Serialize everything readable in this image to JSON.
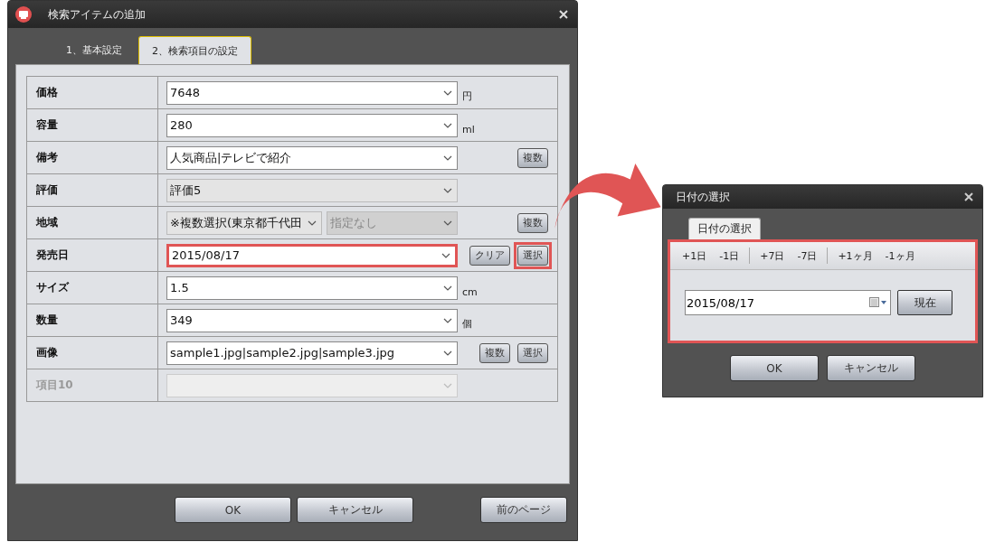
{
  "main_window": {
    "title": "検索アイテムの追加",
    "tabs": [
      {
        "label": "1、基本設定",
        "selected": false
      },
      {
        "label": "2、検索項目の設定",
        "selected": true
      }
    ],
    "rows": [
      {
        "label": "価格",
        "disabled": false,
        "fields": [
          {
            "value": "7648",
            "readonly": false,
            "disabled": false,
            "highlighted": false
          }
        ],
        "unit": "円",
        "buttons": []
      },
      {
        "label": "容量",
        "disabled": false,
        "fields": [
          {
            "value": "280",
            "readonly": false,
            "disabled": false,
            "highlighted": false
          }
        ],
        "unit": "ml",
        "buttons": []
      },
      {
        "label": "備考",
        "disabled": false,
        "fields": [
          {
            "value": "人気商品|テレビで紹介",
            "readonly": false,
            "disabled": false,
            "highlighted": false
          }
        ],
        "buttons": [
          {
            "label": "複数",
            "highlighted": false
          }
        ]
      },
      {
        "label": "評価",
        "disabled": false,
        "fields": [
          {
            "value": "評価5",
            "readonly": true,
            "disabled": false,
            "highlighted": false
          }
        ],
        "buttons": []
      },
      {
        "label": "地域",
        "disabled": false,
        "fields": [
          {
            "value": "※複数選択(東京都千代田",
            "readonly": true,
            "disabled": false,
            "highlighted": false
          },
          {
            "value": "指定なし",
            "readonly": true,
            "disabled": true,
            "highlighted": false
          }
        ],
        "buttons": [
          {
            "label": "複数",
            "highlighted": false
          }
        ]
      },
      {
        "label": "発売日",
        "disabled": false,
        "fields": [
          {
            "value": "2015/08/17",
            "readonly": false,
            "disabled": false,
            "highlighted": true
          }
        ],
        "buttons": [
          {
            "label": "クリア",
            "highlighted": false
          },
          {
            "label": "選択",
            "highlighted": true
          }
        ]
      },
      {
        "label": "サイズ",
        "disabled": false,
        "fields": [
          {
            "value": "1.5",
            "readonly": false,
            "disabled": false,
            "highlighted": false
          }
        ],
        "unit": "cm",
        "buttons": []
      },
      {
        "label": "数量",
        "disabled": false,
        "fields": [
          {
            "value": "349",
            "readonly": false,
            "disabled": false,
            "highlighted": false
          }
        ],
        "unit": "個",
        "buttons": []
      },
      {
        "label": "画像",
        "disabled": false,
        "fields": [
          {
            "value": "sample1.jpg|sample2.jpg|sample3.jpg",
            "readonly": false,
            "disabled": false,
            "highlighted": false
          }
        ],
        "buttons": [
          {
            "label": "複数",
            "highlighted": false
          },
          {
            "label": "選択",
            "highlighted": false
          }
        ]
      },
      {
        "label": "項目10",
        "disabled": true,
        "fields": [
          {
            "readonly": true,
            "disabled": true,
            "highlighted": false
          }
        ],
        "buttons": []
      }
    ],
    "buttons": [
      {
        "label": "OK",
        "kind": "ok"
      },
      {
        "label": "キャンセル",
        "kind": "cancel"
      },
      {
        "label": "前のページ",
        "kind": "back"
      }
    ]
  },
  "date_dialog": {
    "title": "日付の選択",
    "tabs": [
      {
        "label": "日付の選択",
        "selected": true
      }
    ],
    "highlighted": true,
    "toolbar": [
      [
        "+1日",
        "-1日"
      ],
      [
        "+7日",
        "-7日"
      ],
      [
        "+1ヶ月",
        "-1ヶ月"
      ]
    ],
    "date_value": "2015/08/17",
    "now_button": "現在",
    "buttons": [
      {
        "label": "OK"
      },
      {
        "label": "キャンセル"
      }
    ]
  }
}
